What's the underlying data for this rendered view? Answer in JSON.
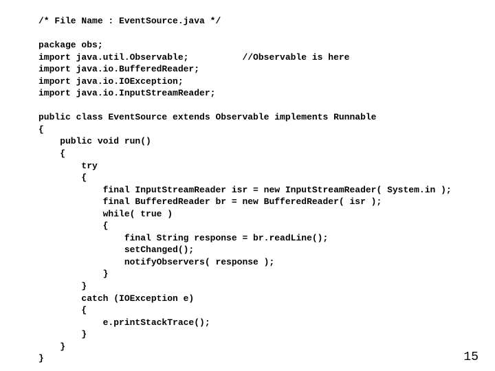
{
  "code": {
    "line01": "/* File Name : EventSource.java */",
    "line02": "",
    "line03": "package obs;",
    "line04": "import java.util.Observable;          //Observable is here",
    "line05": "import java.io.BufferedReader;",
    "line06": "import java.io.IOException;",
    "line07": "import java.io.InputStreamReader;",
    "line08": "",
    "line09": "public class EventSource extends Observable implements Runnable",
    "line10": "{",
    "line11": "    public void run()",
    "line12": "    {",
    "line13": "        try",
    "line14": "        {",
    "line15": "            final InputStreamReader isr = new InputStreamReader( System.in );",
    "line16": "            final BufferedReader br = new BufferedReader( isr );",
    "line17": "            while( true )",
    "line18": "            {",
    "line19": "                final String response = br.readLine();",
    "line20": "                setChanged();",
    "line21": "                notifyObservers( response );",
    "line22": "            }",
    "line23": "        }",
    "line24": "        catch (IOException e)",
    "line25": "        {",
    "line26": "            e.printStackTrace();",
    "line27": "        }",
    "line28": "    }",
    "line29": "}"
  },
  "page_number": "15"
}
